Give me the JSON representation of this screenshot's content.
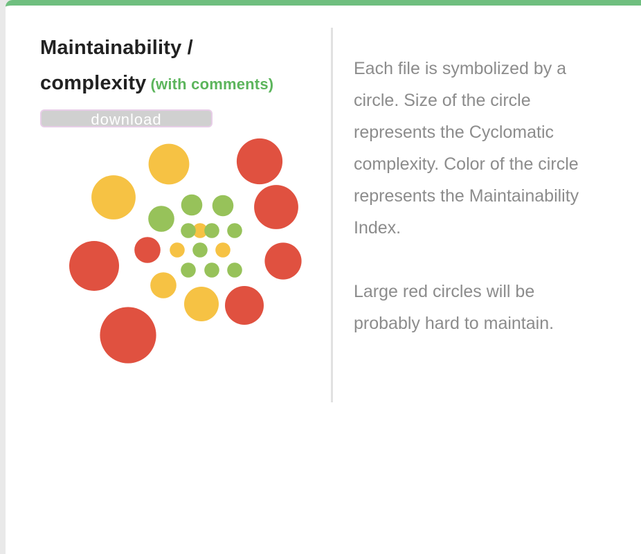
{
  "panel": {
    "title": "Maintainability / complexity",
    "title_suffix": "(with comments)",
    "download_label": "download"
  },
  "description": {
    "paragraph1": "Each file is symbolized by a circle. Size of the circle represents the Cyclomatic complexity. Color of the circle represents the Maintainability Index.",
    "paragraph2": "Large red circles will be probably hard to maintain."
  },
  "colors": {
    "accent_top": "#6fbf7f",
    "good": "#97c25a",
    "warning": "#f6c244",
    "bad": "#e05140"
  },
  "chart_data": {
    "type": "bubble-pack",
    "title": "",
    "legend": "none",
    "files": [
      {
        "level": "bad",
        "complexity": 42
      },
      {
        "level": "bad",
        "complexity": 33
      },
      {
        "level": "bad",
        "complexity": 28
      },
      {
        "level": "bad",
        "complexity": 26
      },
      {
        "level": "bad",
        "complexity": 20
      },
      {
        "level": "bad",
        "complexity": 18
      },
      {
        "level": "bad",
        "complexity": 9
      },
      {
        "level": "warning",
        "complexity": 26
      },
      {
        "level": "warning",
        "complexity": 22
      },
      {
        "level": "warning",
        "complexity": 16
      },
      {
        "level": "warning",
        "complexity": 9
      },
      {
        "level": "warning",
        "complexity": 3
      },
      {
        "level": "warning",
        "complexity": 3
      },
      {
        "level": "warning",
        "complexity": 3
      },
      {
        "level": "good",
        "complexity": 9
      },
      {
        "level": "good",
        "complexity": 6
      },
      {
        "level": "good",
        "complexity": 6
      },
      {
        "level": "good",
        "complexity": 3
      },
      {
        "level": "good",
        "complexity": 3
      },
      {
        "level": "good",
        "complexity": 3
      },
      {
        "level": "good",
        "complexity": 3
      },
      {
        "level": "good",
        "complexity": 3
      },
      {
        "level": "good",
        "complexity": 3
      },
      {
        "level": "good",
        "complexity": 3
      }
    ]
  }
}
